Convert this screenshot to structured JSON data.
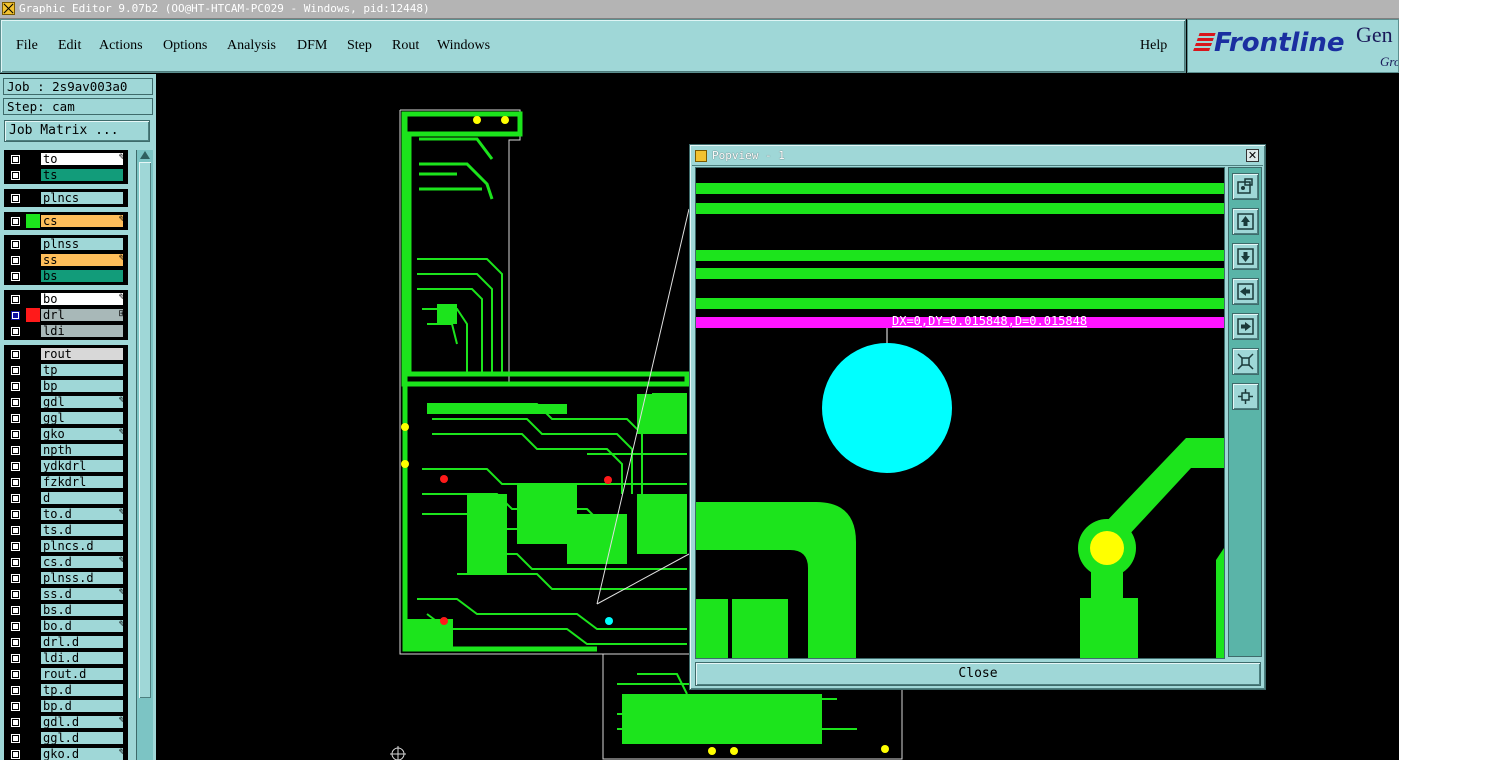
{
  "window": {
    "title": "Graphic Editor 9.07b2 (OO@HT-HTCAM-PC029 - Windows, pid:12448)"
  },
  "menu": {
    "file": "File",
    "edit": "Edit",
    "actions": "Actions",
    "options": "Options",
    "analysis": "Analysis",
    "dfm": "DFM",
    "step": "Step",
    "rout": "Rout",
    "windows": "Windows",
    "help": "Help"
  },
  "brand": {
    "logo": "Frontline",
    "gen": "Gen",
    "gro": "Gro"
  },
  "sidebar": {
    "job": "Job : 2s9av003a0",
    "step": "Step: cam",
    "job_matrix": "Job Matrix ...",
    "layers": [
      {
        "name": "to",
        "color": "#ffffff",
        "affected": true
      },
      {
        "name": "ts",
        "color": "#129c7a",
        "affected": false
      },
      {
        "name": "plncs",
        "color": "#9fd7d7",
        "affected": false
      },
      {
        "name": "cs",
        "color": "#ffbe5a",
        "affected": true,
        "swatch": "#1ce41c"
      },
      {
        "name": "plnss",
        "color": "#9fd7d7",
        "affected": false
      },
      {
        "name": "ss",
        "color": "#ffbe5a",
        "affected": true
      },
      {
        "name": "bs",
        "color": "#129c7a",
        "affected": false
      },
      {
        "name": "bo",
        "color": "#ffffff",
        "affected": true
      },
      {
        "name": "drl",
        "color": "#a8b8b8",
        "affected": false,
        "active": true,
        "swatch": "#ff1a1a"
      },
      {
        "name": "ldi",
        "color": "#a8b8b8",
        "affected": false
      },
      {
        "name": "rout",
        "color": "#d8d8d8",
        "affected": false
      },
      {
        "name": "tp",
        "color": "#9fd7d7",
        "affected": false
      },
      {
        "name": "bp",
        "color": "#9fd7d7",
        "affected": false
      },
      {
        "name": "gdl",
        "color": "#9fd7d7",
        "affected": true
      },
      {
        "name": "ggl",
        "color": "#9fd7d7",
        "affected": false
      },
      {
        "name": "gko",
        "color": "#9fd7d7",
        "affected": true
      },
      {
        "name": "npth",
        "color": "#9fd7d7",
        "affected": false
      },
      {
        "name": "ydkdrl",
        "color": "#9fd7d7",
        "affected": false
      },
      {
        "name": "fzkdrl",
        "color": "#9fd7d7",
        "affected": false
      },
      {
        "name": "d",
        "color": "#9fd7d7",
        "affected": false
      },
      {
        "name": "to.d",
        "color": "#9fd7d7",
        "affected": true
      },
      {
        "name": "ts.d",
        "color": "#9fd7d7",
        "affected": false
      },
      {
        "name": "plncs.d",
        "color": "#9fd7d7",
        "affected": false
      },
      {
        "name": "cs.d",
        "color": "#9fd7d7",
        "affected": true
      },
      {
        "name": "plnss.d",
        "color": "#9fd7d7",
        "affected": false
      },
      {
        "name": "ss.d",
        "color": "#9fd7d7",
        "affected": true
      },
      {
        "name": "bs.d",
        "color": "#9fd7d7",
        "affected": false
      },
      {
        "name": "bo.d",
        "color": "#9fd7d7",
        "affected": true
      },
      {
        "name": "drl.d",
        "color": "#9fd7d7",
        "affected": false
      },
      {
        "name": "ldi.d",
        "color": "#9fd7d7",
        "affected": false
      },
      {
        "name": "rout.d",
        "color": "#9fd7d7",
        "affected": false
      },
      {
        "name": "tp.d",
        "color": "#9fd7d7",
        "affected": false
      },
      {
        "name": "bp.d",
        "color": "#9fd7d7",
        "affected": false
      },
      {
        "name": "gdl.d",
        "color": "#9fd7d7",
        "affected": true
      },
      {
        "name": "ggl.d",
        "color": "#9fd7d7",
        "affected": false
      },
      {
        "name": "gko.d",
        "color": "#9fd7d7",
        "affected": true
      }
    ]
  },
  "popview": {
    "title": "Popview - 1",
    "measurement": "DX=0,DY=0.015848,D=0.015848",
    "close": "Close",
    "tools": [
      "zoom-fit-icon",
      "pan-up-icon",
      "pan-down-icon",
      "pan-left-icon",
      "pan-right-icon",
      "zoom-in-icon",
      "zoom-out-icon"
    ]
  },
  "colors": {
    "ui": "#9fd7d7",
    "canvas": "#000000",
    "copper": "#1ce41c",
    "highlight": "#ff14ff",
    "selected_pad": "#00ffff",
    "pad": "#ffff00",
    "drill": "#ff1a1a"
  }
}
